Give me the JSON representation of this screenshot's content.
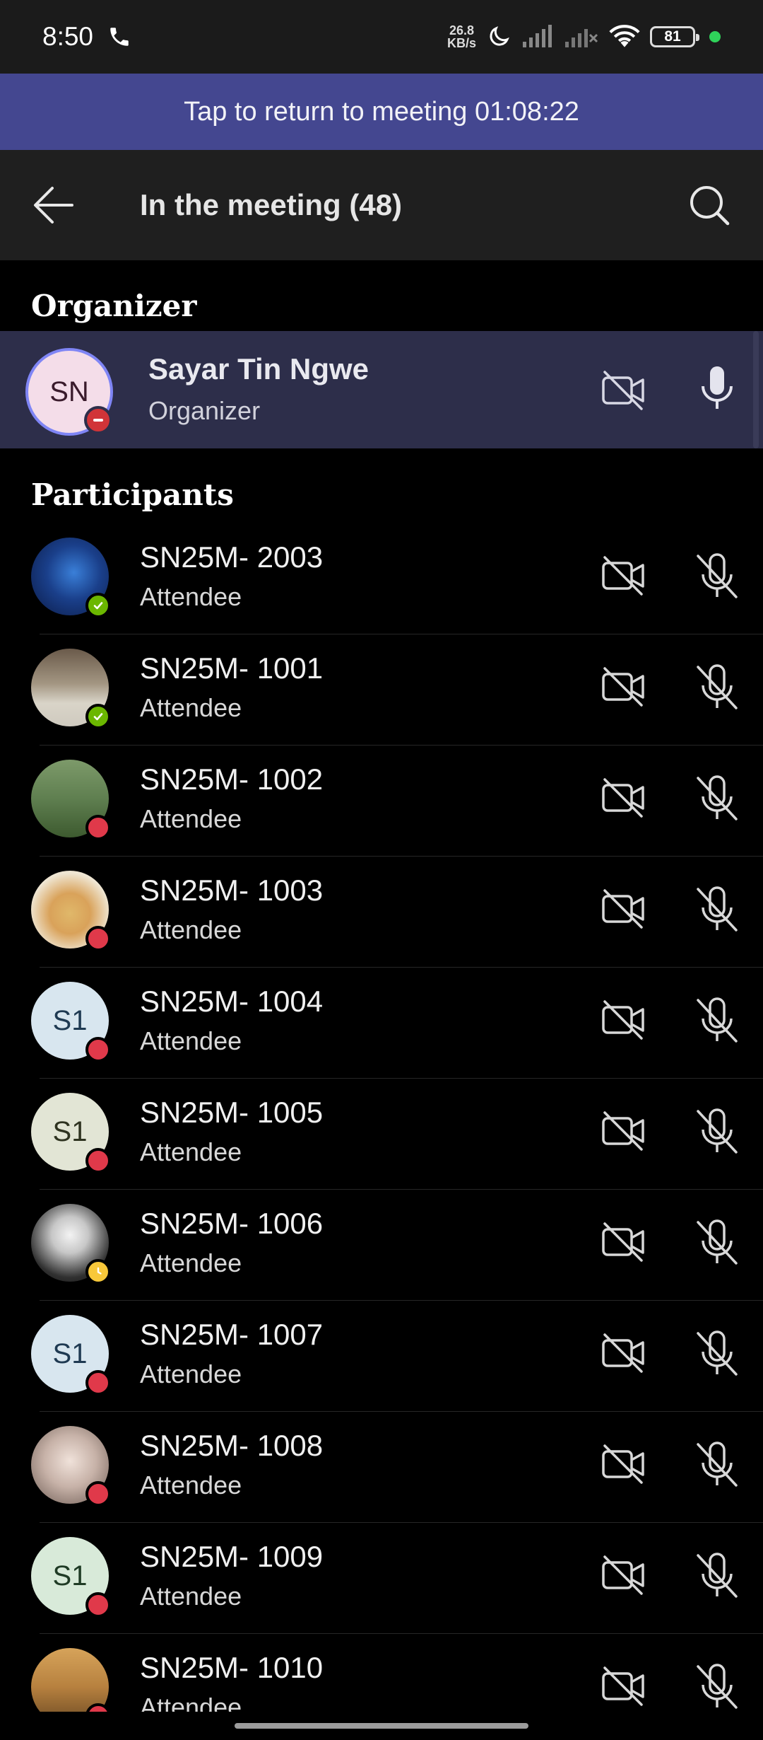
{
  "status_bar": {
    "time": "8:50",
    "net_speed_value": "26.8",
    "net_speed_unit": "KB/s",
    "battery": "81"
  },
  "banner": {
    "label": "Tap to return to meeting 01:08:22"
  },
  "header": {
    "title": "In the meeting (48)"
  },
  "organizer_section": {
    "title": "Organizer",
    "person": {
      "initials": "SN",
      "name": "Sayar Tin Ngwe",
      "role": "Organizer"
    }
  },
  "participants_section": {
    "title": "Participants",
    "items": [
      {
        "name": "SN25M- 2003",
        "role": "Attendee",
        "avatar": "photo-blue",
        "status": "available"
      },
      {
        "name": "SN25M- 1001",
        "role": "Attendee",
        "avatar": "photo-room",
        "status": "available"
      },
      {
        "name": "SN25M- 1002",
        "role": "Attendee",
        "avatar": "photo-snoopy",
        "status": "busy"
      },
      {
        "name": "SN25M- 1003",
        "role": "Attendee",
        "avatar": "photo-frog",
        "status": "busy"
      },
      {
        "name": "SN25M- 1004",
        "role": "Attendee",
        "avatar": "initials-blue",
        "initials": "S1",
        "status": "busy"
      },
      {
        "name": "SN25M- 1005",
        "role": "Attendee",
        "avatar": "initials-olive",
        "initials": "S1",
        "status": "busy"
      },
      {
        "name": "SN25M- 1006",
        "role": "Attendee",
        "avatar": "photo-anime",
        "status": "away"
      },
      {
        "name": "SN25M- 1007",
        "role": "Attendee",
        "avatar": "initials-blue",
        "initials": "S1",
        "status": "busy"
      },
      {
        "name": "SN25M- 1008",
        "role": "Attendee",
        "avatar": "photo-girl",
        "status": "busy"
      },
      {
        "name": "SN25M- 1009",
        "role": "Attendee",
        "avatar": "initials-green",
        "initials": "S1",
        "status": "busy"
      },
      {
        "name": "SN25M- 1010",
        "role": "Attendee",
        "avatar": "photo-desert",
        "status": "busy"
      }
    ]
  },
  "colors": {
    "banner": "#444790",
    "organizer_row": "#2d2e4a",
    "available": "#6bb700",
    "busy": "#e0394a",
    "away": "#f8c83a"
  },
  "icons": {
    "back": "arrow-left-icon",
    "search": "search-icon",
    "camera_off": "video-off-icon",
    "mic_on": "microphone-icon",
    "mic_off": "microphone-off-icon"
  }
}
